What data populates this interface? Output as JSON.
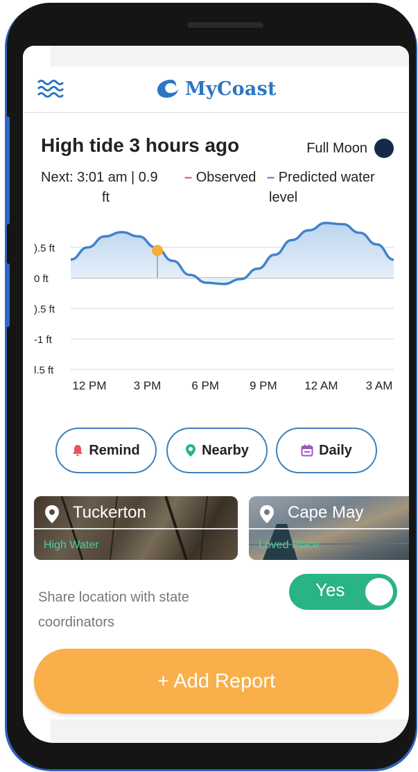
{
  "header": {
    "brand": "MyCoast",
    "menu_icon": "waves-menu-icon",
    "brand_icon": "crescent-wave-icon",
    "brand_color": "#2c76c4"
  },
  "tide": {
    "title": "High tide 3 hours ago",
    "next_label": "Next: 3:01 am | 0.9",
    "next_unit": "ft",
    "moon_label": "Full Moon",
    "moon_color": "#152a4a",
    "legend_observed": "Observed",
    "legend_predicted": "Predicted water",
    "legend_predicted_cont": "level",
    "observed_color": "#e0505a",
    "predicted_color": "#3f83c9"
  },
  "chart_data": {
    "type": "area",
    "title": "",
    "y_ticks": [
      ").5 ft",
      "0 ft",
      ").5 ft",
      "-1 ft",
      "l.5 ft"
    ],
    "y_tick_values": [
      0.5,
      0,
      -0.5,
      -1,
      -1.5
    ],
    "x_ticks": [
      "12 PM",
      "3 PM",
      "6 PM",
      "9 PM",
      "12 AM",
      "3 AM"
    ],
    "ylim": [
      -1.6,
      0.95
    ],
    "grid": true,
    "series": [
      {
        "values_hours": [
          0,
          1,
          2,
          3,
          4,
          5,
          6,
          7,
          8,
          9,
          10,
          11,
          12,
          13,
          14,
          15,
          16,
          17,
          18,
          19
        ],
        "values_ft": [
          0.3,
          0.5,
          0.68,
          0.75,
          0.68,
          0.5,
          0.28,
          0.05,
          -0.08,
          -0.1,
          -0.02,
          0.15,
          0.38,
          0.62,
          0.78,
          0.9,
          0.88,
          0.74,
          0.55,
          0.3
        ]
      }
    ],
    "current_marker": {
      "hour": 5.1,
      "ft": 0.45,
      "color": "#f5ad3c"
    }
  },
  "actions": [
    {
      "label": "Remind",
      "icon": "bell-icon",
      "icon_color": "#e8545b"
    },
    {
      "label": "Nearby",
      "icon": "location-pin-icon",
      "icon_color": "#2ab385"
    },
    {
      "label": "Daily",
      "icon": "calendar-icon",
      "icon_color": "#9b59c5"
    }
  ],
  "locations": [
    {
      "name": "Tuckerton",
      "tag": "High Water"
    },
    {
      "name": "Cape May",
      "tag": "Loved Place"
    }
  ],
  "share": {
    "text": "Share location with state coordinators",
    "toggle_label": "Yes",
    "toggle_color": "#2ab385"
  },
  "add_report": {
    "label": "+ Add Report",
    "color": "#f9b04a"
  }
}
